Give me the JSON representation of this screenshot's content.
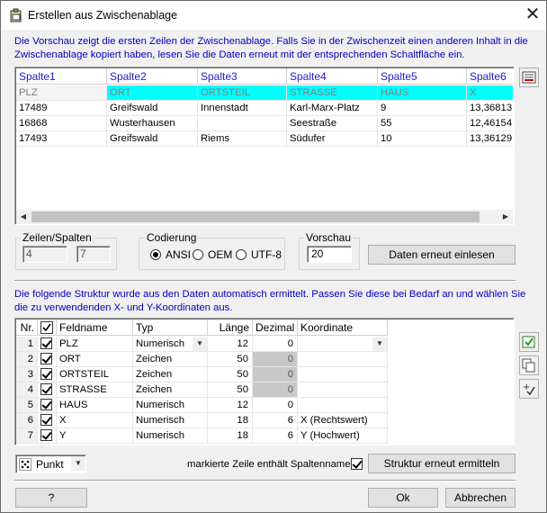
{
  "window": {
    "title": "Erstellen aus Zwischenablage",
    "close": "✕"
  },
  "info_top": "Die Vorschau zeigt die ersten Zeilen der Zwischenablage. Falls Sie in der Zwischenzeit einen anderen Inhalt in die Zwischenablage kopiert haben, lesen Sie die Daten erneut mit der entsprechenden Schaltfläche ein.",
  "preview": {
    "headers": [
      "Spalte1",
      "Spalte2",
      "Spalte3",
      "Spalte4",
      "Spalte5",
      "Spalte6"
    ],
    "rows": [
      [
        "PLZ",
        "ORT",
        "ORTSTEIL",
        "STRASSE",
        "HAUS",
        "X"
      ],
      [
        "17489",
        "Greifswald",
        "Innenstadt",
        "Karl-Marx-Platz",
        "9",
        "13,36813"
      ],
      [
        "16868",
        "Wusterhausen",
        "",
        "Seestraße",
        "55",
        "12,46154"
      ],
      [
        "17493",
        "Greifswald",
        "Riems",
        "Südufer",
        "10",
        "13,36129"
      ]
    ],
    "header_row_color": "#00ffff"
  },
  "zeilen_spalten": {
    "label": "Zeilen/Spalten",
    "zeilen": "4",
    "spalten": "7"
  },
  "codierung": {
    "label": "Codierung",
    "options": [
      "ANSI",
      "OEM",
      "UTF-8"
    ],
    "selected": "ANSI"
  },
  "vorschau": {
    "label": "Vorschau",
    "value": "20"
  },
  "reload_button": "Daten erneut einlesen",
  "info_mid": "Die folgende Struktur wurde aus den Daten automatisch ermittelt. Passen Sie diese bei Bedarf an und wählen Sie die zu verwendenden X- und Y-Koordinaten aus.",
  "structure": {
    "headers": {
      "nr": "Nr.",
      "feldname": "Feldname",
      "typ": "Typ",
      "laenge": "Länge",
      "dezimal": "Dezimal",
      "koordinate": "Koordinate"
    },
    "rows": [
      {
        "nr": "1",
        "name": "PLZ",
        "typ": "Numerisch",
        "laenge": "12",
        "dezimal": "0",
        "koord": ""
      },
      {
        "nr": "2",
        "name": "ORT",
        "typ": "Zeichen",
        "laenge": "50",
        "dezimal": "0",
        "koord": ""
      },
      {
        "nr": "3",
        "name": "ORTSTEIL",
        "typ": "Zeichen",
        "laenge": "50",
        "dezimal": "0",
        "koord": ""
      },
      {
        "nr": "4",
        "name": "STRASSE",
        "typ": "Zeichen",
        "laenge": "50",
        "dezimal": "0",
        "koord": ""
      },
      {
        "nr": "5",
        "name": "HAUS",
        "typ": "Numerisch",
        "laenge": "12",
        "dezimal": "0",
        "koord": ""
      },
      {
        "nr": "6",
        "name": "X",
        "typ": "Numerisch",
        "laenge": "18",
        "dezimal": "6",
        "koord": "X (Rechtswert)"
      },
      {
        "nr": "7",
        "name": "Y",
        "typ": "Numerisch",
        "laenge": "18",
        "dezimal": "6",
        "koord": "Y (Hochwert)"
      }
    ]
  },
  "geometry_select": {
    "value": "Punkt"
  },
  "first_row_names": {
    "label": "markierte Zeile enthält Spaltennamen"
  },
  "restructure_button": "Struktur erneut ermitteln",
  "help_button": "?",
  "ok_button": "Ok",
  "cancel_button": "Abbrechen"
}
